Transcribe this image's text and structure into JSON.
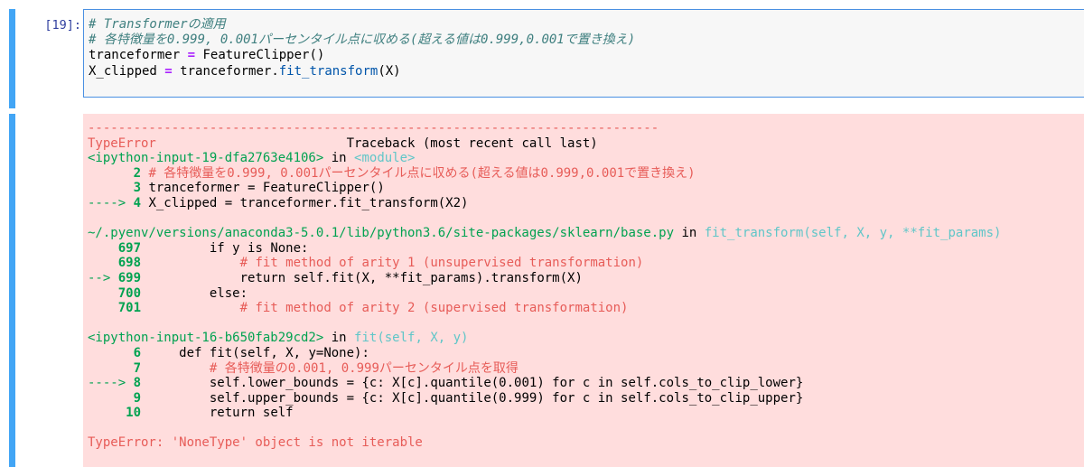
{
  "input_cell": {
    "prompt": "[19]:",
    "lines": [
      {
        "comment": "# Transformerの適用"
      },
      {
        "comment": "# 各特徴量を0.999, 0.001パーセンタイル点に収める(超える値は0.999,0.001で置き換え)"
      },
      {
        "var": "tranceformer",
        "op": "=",
        "rest": "FeatureClipper()"
      },
      {
        "var": "X_clipped",
        "op": "=",
        "obj": "tranceformer.",
        "fn": "fit_transform",
        "rest": "(X)"
      }
    ]
  },
  "output_cell": {
    "separator": "---------------------------------------------------------------------------",
    "error_name": "TypeError",
    "traceback_header": "Traceback (most recent call last)",
    "frames": [
      {
        "location": "<ipython-input-19-dfa2763e4106>",
        "in_word": "in",
        "func": "<module>",
        "lines": [
          {
            "marker": "      ",
            "num": "2",
            "code": "# 各特徴量を0.999, 0.001パーセンタイル点に収める(超える値は0.999,0.001で置き換え)",
            "type": "comment"
          },
          {
            "marker": "      ",
            "num": "3",
            "code": "tranceformer = FeatureClipper()",
            "type": "code"
          },
          {
            "marker": "----> ",
            "num": "4",
            "code": "X_clipped = tranceformer.fit_transform(X2)",
            "type": "code"
          }
        ]
      },
      {
        "location": "~/.pyenv/versions/anaconda3-5.0.1/lib/python3.6/site-packages/sklearn/base.py",
        "in_word": "in",
        "func": "fit_transform(self, X, y, **fit_params)",
        "lines": [
          {
            "marker": "    ",
            "num": "697",
            "code": "        if y is None:",
            "type": "code"
          },
          {
            "marker": "    ",
            "num": "698",
            "code": "            # fit method of arity 1 (unsupervised transformation)",
            "type": "comment"
          },
          {
            "marker": "--> ",
            "num": "699",
            "code": "            return self.fit(X, **fit_params).transform(X)",
            "type": "code"
          },
          {
            "marker": "    ",
            "num": "700",
            "code": "        else:",
            "type": "code"
          },
          {
            "marker": "    ",
            "num": "701",
            "code": "            # fit method of arity 2 (supervised transformation)",
            "type": "comment"
          }
        ]
      },
      {
        "location": "<ipython-input-16-b650fab29cd2>",
        "in_word": "in",
        "func": "fit(self, X, y)",
        "lines": [
          {
            "marker": "      ",
            "num": "6",
            "code": "    def fit(self, X, y=None):",
            "type": "code"
          },
          {
            "marker": "      ",
            "num": "7",
            "code": "        # 各特徴量の0.001, 0.999パーセンタイル点を取得",
            "type": "comment"
          },
          {
            "marker": "----> ",
            "num": "8",
            "code": "        self.lower_bounds = {c: X[c].quantile(0.001) for c in self.cols_to_clip_lower}",
            "type": "code"
          },
          {
            "marker": "      ",
            "num": "9",
            "code": "        self.upper_bounds = {c: X[c].quantile(0.999) for c in self.cols_to_clip_upper}",
            "type": "code"
          },
          {
            "marker": "     ",
            "num": "10",
            "code": "        return self",
            "type": "code"
          }
        ]
      }
    ],
    "final_error": "TypeError: 'NoneType' object is not iterable"
  }
}
